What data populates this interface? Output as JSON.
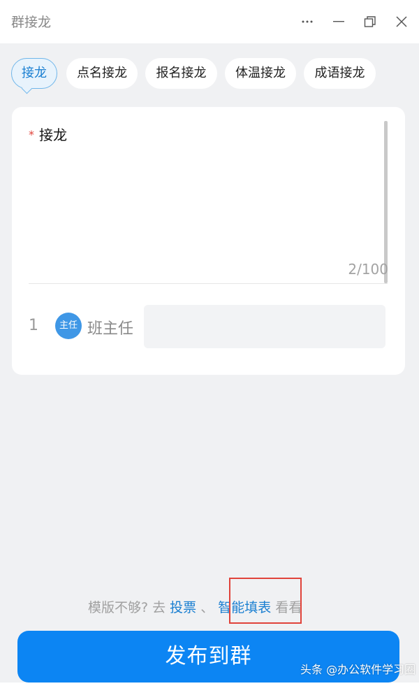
{
  "window": {
    "title": "群接龙"
  },
  "tabs": [
    {
      "label": "接龙",
      "active": true
    },
    {
      "label": "点名接龙",
      "active": false
    },
    {
      "label": "报名接龙",
      "active": false
    },
    {
      "label": "体温接龙",
      "active": false
    },
    {
      "label": "成语接龙",
      "active": false
    }
  ],
  "form": {
    "required_mark": "*",
    "field_label": "接龙",
    "char_counter": "2/100",
    "rows": [
      {
        "index": "1",
        "avatar_text": "主任",
        "name": "班主任",
        "value": ""
      }
    ]
  },
  "footer": {
    "hint_prefix": "模版不够? 去",
    "link_vote": "投票",
    "separator": "、",
    "link_smart_form": "智能填表",
    "hint_suffix": "看看",
    "publish_label": "发布到群"
  },
  "watermark": {
    "text": "头条 @办公软件学习圈"
  },
  "colors": {
    "accent": "#0c85f3",
    "link": "#1a7fd1",
    "background": "#f0f1f3",
    "required": "#e0433a",
    "highlight_box": "#e0433a",
    "avatar": "#3f97e6"
  },
  "icons": {
    "more": "more-horizontal-icon",
    "minimize": "minimize-icon",
    "restore": "restore-window-icon",
    "close": "close-icon"
  }
}
